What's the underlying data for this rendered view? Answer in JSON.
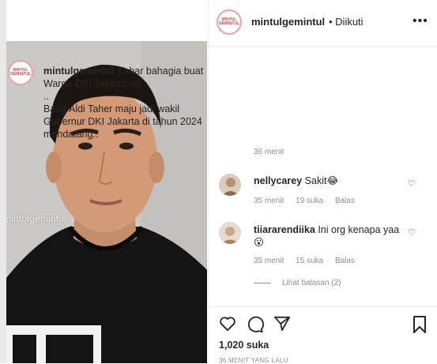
{
  "watermark": "mintulgemintul",
  "post": {
    "username": "mintulgemintul",
    "follow_status": "• Diikuti",
    "more_icon": "more-icon",
    "avatar_logo": "MINTUL GEMINTUL",
    "caption_username": "mintulgemintul",
    "caption_lines": [
      "Kabar bahagia buat",
      "Warga DKI Jakarta nih..",
      "..",
      "Bang Aldi Taher maju jadi wakil",
      "Gubernur DKI Jakarta di tahun 2024",
      "mendatang.."
    ],
    "caption_time": "36 menit"
  },
  "comments": [
    {
      "username": "nellycarey",
      "text": "Sakit😂",
      "time": "35 menit",
      "likes": "19 suka",
      "reply": "Balas"
    },
    {
      "username": "tiiararendiika",
      "text": "Ini org kenapa yaa",
      "text2": "😮",
      "time": "35 menit",
      "likes": "15 suka",
      "reply": "Balas"
    }
  ],
  "view_replies": "Lihat balasan (2)",
  "likes_count": "1,020 suka",
  "posted_time": "36 MENIT YANG LALU"
}
